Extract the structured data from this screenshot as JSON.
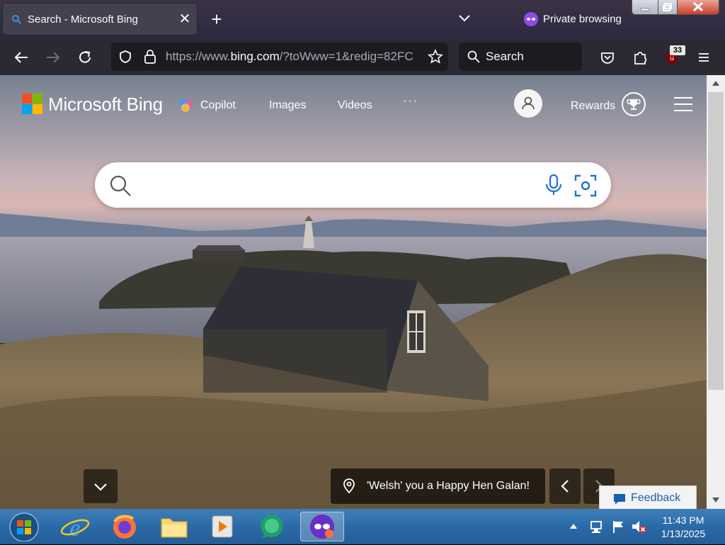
{
  "browser": {
    "tab_title": "Search - Microsoft Bing",
    "private_label": "Private browsing",
    "url_prefix": "https://www.",
    "url_domain": "bing.com",
    "url_rest": "/?toWww=1&redig=82FC",
    "search_label": "Search",
    "extension_badge": "33"
  },
  "bing": {
    "brand": "Microsoft Bing",
    "nav": [
      "Copilot",
      "Images",
      "Videos"
    ],
    "more": "···",
    "rewards": "Rewards",
    "caption": "'Welsh' you a Happy Hen Galan!",
    "feedback": "Feedback"
  },
  "taskbar": {
    "time": "11:43 PM",
    "date": "1/13/2025"
  },
  "colors": {
    "accent_private": "#8f4ae8",
    "ms_red": "#f25022",
    "ms_green": "#7fba00",
    "ms_blue": "#00a4ef",
    "ms_yellow": "#ffb900"
  }
}
